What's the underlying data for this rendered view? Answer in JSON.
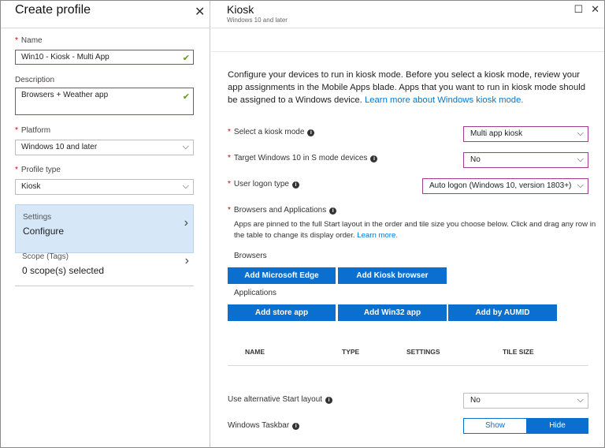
{
  "left": {
    "title": "Create profile",
    "name_label": "Name",
    "name_value": "Win10 - Kiosk - Multi App",
    "description_label": "Description",
    "description_value": "Browsers + Weather app",
    "platform_label": "Platform",
    "platform_value": "Windows 10 and later",
    "profile_type_label": "Profile type",
    "profile_type_value": "Kiosk",
    "settings": {
      "label": "Settings",
      "value": "Configure"
    },
    "scope": {
      "label": "Scope (Tags)",
      "value": "0 scope(s) selected"
    }
  },
  "right": {
    "title": "Kiosk",
    "subtitle": "Windows 10 and later",
    "intro": "Configure your devices to run in kiosk mode. Before you select a kiosk mode, review your app assignments in the Mobile Apps blade. Apps that you want to run in kiosk mode should be assigned to a Windows device. ",
    "intro_link": "Learn more about Windows kiosk mode.",
    "kiosk_mode_label": "Select a kiosk mode",
    "kiosk_mode_value": "Multi app kiosk",
    "s_mode_label": "Target Windows 10 in S mode devices",
    "s_mode_value": "No",
    "logon_label": "User logon type",
    "logon_value": "Auto logon (Windows 10, version 1803+)",
    "browsers_apps_label": "Browsers and Applications",
    "browsers_apps_desc": "Apps are pinned to the full Start layout in the order and tile size you choose below. Click and drag any row in the table to change its display order. ",
    "browsers_apps_link": "Learn more.",
    "browsers_heading": "Browsers",
    "add_edge": "Add Microsoft Edge",
    "add_kiosk_browser": "Add Kiosk browser",
    "applications_heading": "Applications",
    "add_store_app": "Add store app",
    "add_win32_app": "Add Win32 app",
    "add_aumid": "Add by AUMID",
    "table_headers": {
      "name": "NAME",
      "type": "TYPE",
      "settings": "SETTINGS",
      "tile_size": "TILE SIZE"
    },
    "alt_start_label": "Use alternative Start layout",
    "alt_start_value": "No",
    "taskbar_label": "Windows Taskbar",
    "taskbar_show": "Show",
    "taskbar_hide": "Hide"
  },
  "icons": {
    "close": "close-icon",
    "maximize": "maximize-icon",
    "chevron": "chevron-down-icon",
    "info": "info-icon",
    "check": "check-icon"
  },
  "colors": {
    "accent": "#0b6fcf",
    "valid_border": "#a23c8c",
    "check": "#5f9a1a",
    "selected_nav": "#d6e8f7"
  }
}
